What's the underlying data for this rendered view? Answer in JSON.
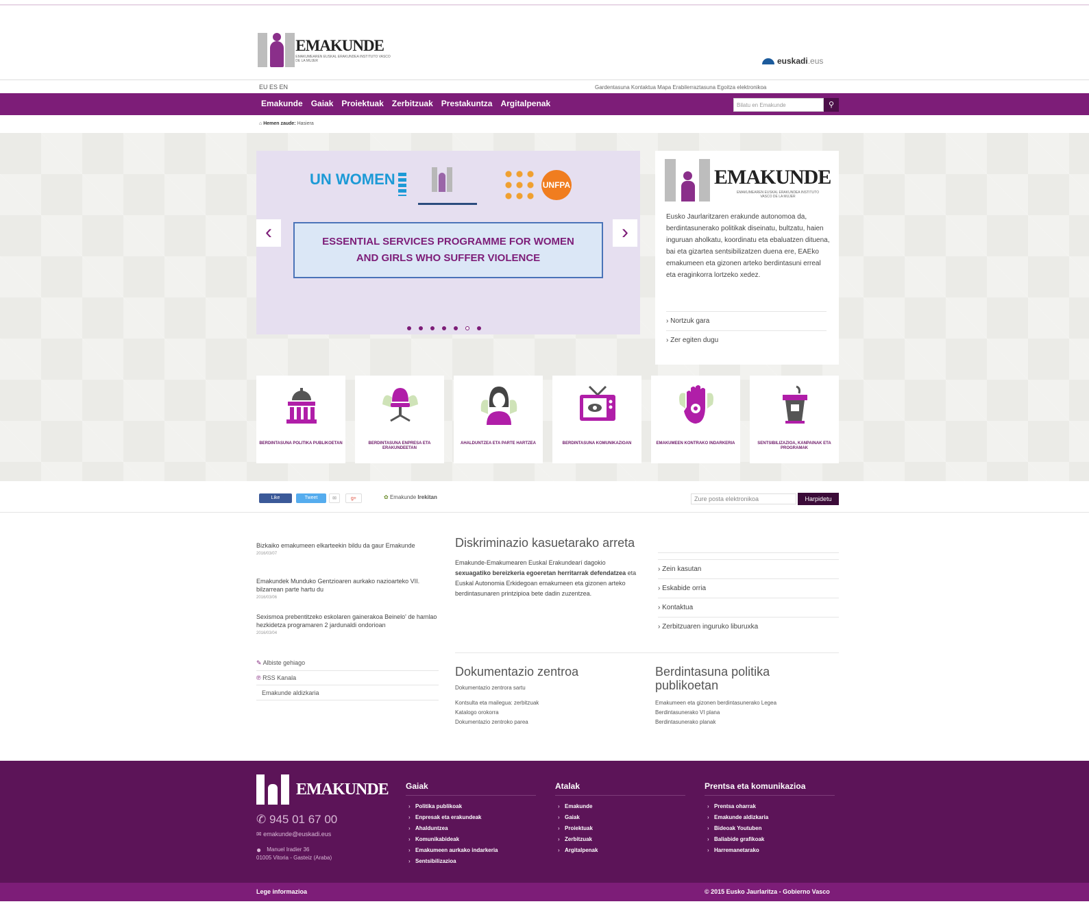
{
  "header": {
    "logo_title": "EMAKUNDE",
    "logo_subtitle": "EMAKUMEAREN EUSKAL ERAKUNDEA INSTITUTO VASCO DE LA MUJER",
    "euskadi_name": "euskadi",
    "euskadi_suffix": ".eus",
    "languages": "EU  ES  EN",
    "utility_links": "Gardentasuna  Kontaktua  Mapa  Erabilerraztasuna  Egoitza elektronikoa"
  },
  "nav": {
    "items": [
      "Emakunde",
      "Gaiak",
      "Proiektuak",
      "Zerbitzuak",
      "Prestakuntza",
      "Argitalpenak"
    ],
    "search_placeholder": "Bilatu en Emakunde",
    "search_icon": "magnifier-icon"
  },
  "breadcrumb": {
    "home": "Hemen zaude:",
    "current": "Hasiera"
  },
  "slider": {
    "partner1": "UN WOMEN",
    "partner3": "UNFPA",
    "banner": "ESSENTIAL SERVICES PROGRAMME FOR WOMEN AND GIRLS WHO SUFFER VIOLENCE",
    "dot_count": 7,
    "active_dot": 5,
    "prev": "‹",
    "next": "›"
  },
  "infocard": {
    "title": "EMAKUNDE",
    "subtitle": "EMAKUMEAREN EUSKAL ERAKUNDEA INSTITUTO VASCO DE LA MUJER",
    "text": "Eusko Jaurlaritzaren erakunde autonomoa da, berdintasunerako politikak diseinatu, bultzatu, haien inguruan aholkatu, koordinatu eta ebaluatzen dituena, bai eta gizartea sentsibilizatzen duena ere, EAEko emakumeen eta gizonen arteko berdintasuni erreal eta eraginkorra lortzeko xedez.",
    "links": [
      "Nortzuk gara",
      "Zer egiten dugu"
    ]
  },
  "tiles": [
    {
      "label": "BERDINTASUNA POLITIKA PUBLIKOETAN",
      "icon": "government-building-icon"
    },
    {
      "label": "BERDINTASUNA ENPRESA ETA ERAKUNDEETAN",
      "icon": "office-chair-icon"
    },
    {
      "label": "AHALDUNTZEA ETA PARTE HARTZEA",
      "icon": "woman-icon"
    },
    {
      "label": "BERDINTASUNA KOMUNIKAZIOAN",
      "icon": "television-icon"
    },
    {
      "label": "EMAKUMEEN KONTRAKO INDARKERIA",
      "icon": "stop-hand-icon"
    },
    {
      "label": "SENTSIBILIZAZIOA, KANPAINAK ETA PROGRAMAK",
      "icon": "podium-icon"
    }
  ],
  "share": {
    "facebook": "Like",
    "twitter": "Tweet",
    "social_label": "Emakunde",
    "social_strong": "Irekitan",
    "newsletter_placeholder": "Zure posta elektronikoa",
    "newsletter_button": "Harpidetu"
  },
  "news": [
    {
      "title": "Bizkaiko emakumeen elkarteekin bildu da gaur Emakunde",
      "date": "2016/03/07"
    },
    {
      "title": "Emakundek Munduko Gentzioaren aurkako nazioarteko VII. bilzarrean parte hartu du",
      "date": "2016/03/06"
    },
    {
      "title": "Sexismoa prebentitzeko eskolaren gainerakoa Beinelo' de hamlao hezkidetza programaren 2 jardunaldi ondorioan",
      "date": "2016/03/04"
    }
  ],
  "news_links": [
    "Albiste gehiago",
    "RSS Kanala",
    "Emakunde aldizkaria"
  ],
  "discrimination": {
    "title": "Diskriminazio kasuetarako arreta",
    "text_before": "Emakunde-Emakumearen Euskal Erakundearí dagokio",
    "text_strong": "sexuagatiko bereizkeria egoeretan herritarrak defendatzea",
    "text_after": "eta Euskal Autonomia Erkidegoan emakumeen eta gizonen arteko berdintasunaren printzipioa bete dadin zuzentzea.",
    "links": [
      "Zein kasutan",
      "Eskabide orria",
      "Kontaktua",
      "Zerbitzuaren inguruko liburuxka"
    ]
  },
  "docs": {
    "title": "Dokumentazio zentroa",
    "sub": "Dokumentazio zentrora sartu",
    "items": [
      "Kontsulta eta mailegua: zerbitzuak",
      "Katalogo orokorra",
      "Dokumentazio zentroko parea"
    ]
  },
  "policy": {
    "title": "Berdintasuna politika publikoetan",
    "items": [
      "Emakumeen eta gizonen berdintasunerako Legea",
      "Berdintasunerako VI plana",
      "Berdintasunerako planak"
    ]
  },
  "footer": {
    "logo": "EMAKUNDE",
    "phone": "945 01 67 00",
    "email": "emakunde@euskadi.eus",
    "address_line1": "Manuel Iradier 36",
    "address_line2": "01005 Vitoria - Gasteiz (Araba)",
    "col1_title": "Gaiak",
    "col1": [
      "Politika publikoak",
      "Enpresak eta erakundeak",
      "Ahalduntzea",
      "Komunikabideak",
      "Emakumeen aurkako indarkeria",
      "Sentsibilizazioa"
    ],
    "col2_title": "Atalak",
    "col2": [
      "Emakunde",
      "Gaiak",
      "Proiektuak",
      "Zerbitzuak",
      "Argitalpenak"
    ],
    "col3_title": "Prentsa eta komunikazioa",
    "col3": [
      "Prentsa oharrak",
      "Emakunde aldizkaria",
      "Bideoak Youtuben",
      "Baliabide grafikoak",
      "Harremanetarako"
    ],
    "bar_left": "Lege informazioa",
    "bar_right": "© 2015 Eusko Jaurlaritza - Gobierno Vasco"
  },
  "colors": {
    "brand_purple": "#7d1d78",
    "footer_purple": "#5c1458",
    "banner_border": "#4a73b8"
  }
}
